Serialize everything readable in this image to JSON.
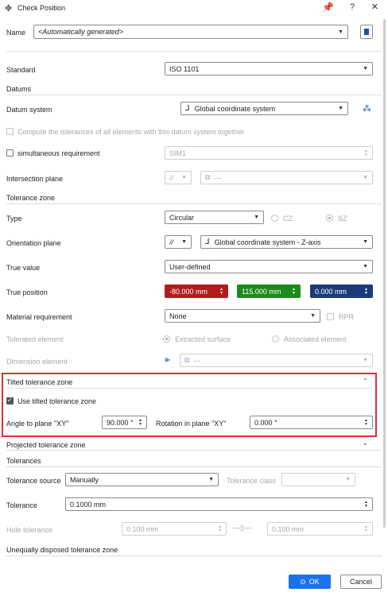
{
  "titlebar": {
    "title": "Check Position",
    "help": "?",
    "close": "×"
  },
  "name": {
    "label": "Name",
    "value": "<Automatically generated>"
  },
  "standard": {
    "label": "Standard",
    "value": "ISO 1101"
  },
  "datums": {
    "heading": "Datums",
    "system_label": "Datum system",
    "system_value": "Global coordinate system",
    "compute_all": "Compute the tolerances of all elements with this datum system together",
    "simultaneous_label": "simultaneous requirement",
    "simultaneous_value": "SIM1",
    "intersection_label": "Intersection plane",
    "intersection_symbol": "//",
    "intersection_value": "---"
  },
  "tolerance_zone": {
    "heading": "Tolerance zone",
    "type_label": "Type",
    "type_value": "Circular",
    "cz": "CZ",
    "sz": "SZ",
    "orientation_label": "Orientation plane",
    "orientation_symbol": "//",
    "orientation_value": "Global coordinate system - Z-axis",
    "true_value_label": "True value",
    "true_value_value": "User-defined",
    "true_position_label": "True position",
    "pos_x": "-80.000 mm",
    "pos_y": "115.000 mm",
    "pos_z": "0.000 mm",
    "material_label": "Material requirement",
    "material_value": "None",
    "rpr": "RPR",
    "toleranced_label": "Tolerated element",
    "extracted": "Extracted surface",
    "associated": "Associated element",
    "dimension_label": "Dimension element",
    "dimension_value": "---"
  },
  "tilted": {
    "heading": "Tilted tolerance zone",
    "use_label": "Use tilted tolerance zone",
    "angle_label": "Angle to plane \"XY\"",
    "angle_value": "90.000 °",
    "rotation_label": "Rotation in plane \"XY\"",
    "rotation_value": "0.000 °"
  },
  "projected": {
    "heading": "Projected tolerance zone"
  },
  "tolerances": {
    "heading": "Tolerances",
    "source_label": "Tolerance source",
    "source_value": "Manually",
    "class_label": "Tolerance class",
    "tolerance_label": "Tolerance",
    "tolerance_value": "0.1000 mm",
    "hole_label": "Hole tolerance",
    "hole_value": "0.100 mm",
    "shaft_value": "0.100 mm"
  },
  "unequal": {
    "heading": "Unequally disposed tolerance zone"
  },
  "footer": {
    "ok": "OK",
    "cancel": "Cancel"
  },
  "colors": {
    "pos_x": "#b01c1c",
    "pos_y": "#1e8a1e",
    "pos_z": "#1c3a7a",
    "highlight": "#e03030",
    "ok": "#1a73e8"
  }
}
